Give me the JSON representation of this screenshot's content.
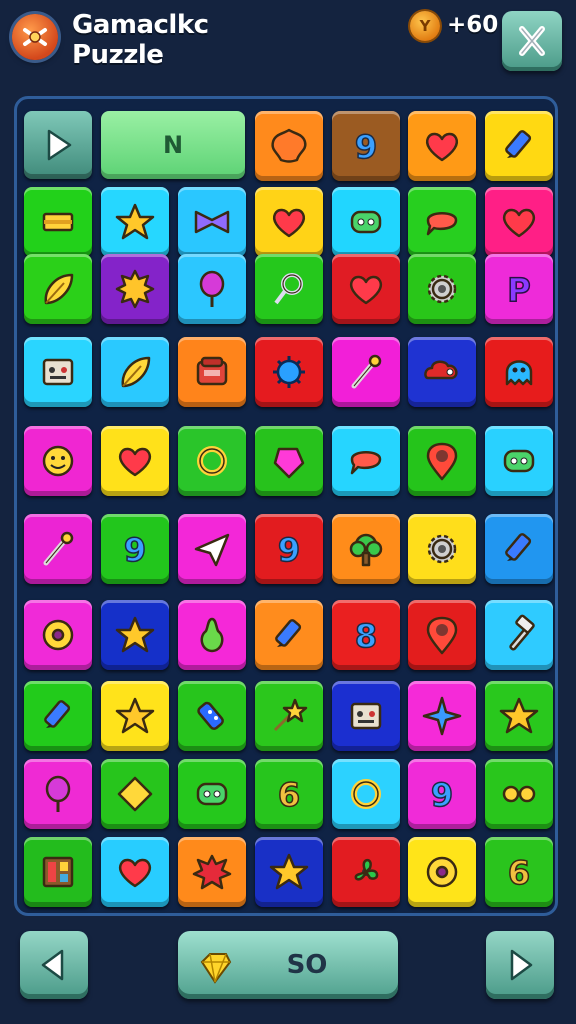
{
  "header": {
    "title_line1": "Gamaclkc",
    "title_line2": "Puzzle",
    "coin_icon_letter": "Y",
    "coin_value": "+60"
  },
  "board": {
    "first_row_label": "N",
    "rows": [
      [
        {
          "color": "#ff8a1c",
          "icon": "star-blob"
        },
        {
          "color": "#9b5b22",
          "icon": "number-9"
        },
        {
          "color": "#ff9a16",
          "icon": "heart"
        },
        {
          "color": "#ffd912",
          "icon": "marker"
        }
      ],
      [
        {
          "color": "#22d11a",
          "icon": "block"
        },
        {
          "color": "#26d7ff",
          "icon": "star"
        },
        {
          "color": "#2ac7ff",
          "icon": "bow"
        },
        {
          "color": "#ffd317",
          "icon": "heart"
        },
        {
          "color": "#21d6ff",
          "icon": "face"
        },
        {
          "color": "#27cf1f",
          "icon": "speech-bubble"
        },
        {
          "color": "#ff1f86",
          "icon": "heart"
        }
      ],
      [
        {
          "color": "#2bd019",
          "icon": "leaf"
        },
        {
          "color": "#8423c9",
          "icon": "sun"
        },
        {
          "color": "#2cc7ff",
          "icon": "balloon"
        },
        {
          "color": "#25c81c",
          "icon": "key-ring"
        },
        {
          "color": "#e01c24",
          "icon": "heart"
        },
        {
          "color": "#29c619",
          "icon": "gear"
        },
        {
          "color": "#ee2bd9",
          "icon": "letter-p"
        }
      ],
      [
        {
          "color": "#2ad5ff",
          "icon": "robot"
        },
        {
          "color": "#2ac9ff",
          "icon": "leaf"
        },
        {
          "color": "#ff841b",
          "icon": "box"
        },
        {
          "color": "#e51b1f",
          "icon": "spiky-ball"
        },
        {
          "color": "#f21fd8",
          "icon": "wand"
        },
        {
          "color": "#1f33d2",
          "icon": "cloud"
        },
        {
          "color": "#e71c1c",
          "icon": "octopus"
        }
      ],
      [
        {
          "color": "#f026d2",
          "icon": "smiley"
        },
        {
          "color": "#ffe11a",
          "icon": "heart"
        },
        {
          "color": "#2ac52a",
          "icon": "ring"
        },
        {
          "color": "#27c21c",
          "icon": "gem"
        },
        {
          "color": "#26d5ff",
          "icon": "speech-bubble"
        },
        {
          "color": "#25c41b",
          "icon": "pin"
        },
        {
          "color": "#29d1ff",
          "icon": "face"
        }
      ],
      [
        {
          "color": "#ec24d4",
          "icon": "wand"
        },
        {
          "color": "#22c61c",
          "icon": "number-9"
        },
        {
          "color": "#f327d8",
          "icon": "paper-plane"
        },
        {
          "color": "#e21c1f",
          "icon": "number-9"
        },
        {
          "color": "#ff8c1a",
          "icon": "tree"
        },
        {
          "color": "#ffde1b",
          "icon": "gear"
        },
        {
          "color": "#2196f0",
          "icon": "marker"
        }
      ],
      [
        {
          "color": "#f02ad8",
          "icon": "donut"
        },
        {
          "color": "#1530c9",
          "icon": "star"
        },
        {
          "color": "#f528d8",
          "icon": "pear"
        },
        {
          "color": "#ff8c1d",
          "icon": "marker"
        },
        {
          "color": "#ea2020",
          "icon": "number-8"
        },
        {
          "color": "#e31d1d",
          "icon": "pin"
        },
        {
          "color": "#2fcbff",
          "icon": "hammer"
        }
      ],
      [
        {
          "color": "#22cb1b",
          "icon": "marker"
        },
        {
          "color": "#ffe31b",
          "icon": "star"
        },
        {
          "color": "#27c51c",
          "icon": "usb"
        },
        {
          "color": "#2bc71c",
          "icon": "pin-star"
        },
        {
          "color": "#1b2fd0",
          "icon": "robot"
        },
        {
          "color": "#f52ad8",
          "icon": "sparkle"
        },
        {
          "color": "#29c81d",
          "icon": "star"
        }
      ],
      [
        {
          "color": "#ef2ad4",
          "icon": "balloon"
        },
        {
          "color": "#27c51c",
          "icon": "diamond"
        },
        {
          "color": "#25c81c",
          "icon": "face"
        },
        {
          "color": "#27c51d",
          "icon": "number-6"
        },
        {
          "color": "#2cd2ff",
          "icon": "ring"
        },
        {
          "color": "#f02bd8",
          "icon": "number-9"
        },
        {
          "color": "#29c61c",
          "icon": "glasses"
        }
      ],
      [
        {
          "color": "#23bc1d",
          "icon": "window"
        },
        {
          "color": "#28cdff",
          "icon": "heart"
        },
        {
          "color": "#ff8a1b",
          "icon": "splat"
        },
        {
          "color": "#1930c6",
          "icon": "star"
        },
        {
          "color": "#e21c21",
          "icon": "fan"
        },
        {
          "color": "#ffe419",
          "icon": "donut"
        },
        {
          "color": "#2ac41d",
          "icon": "number-6"
        }
      ]
    ]
  },
  "footer": {
    "score_value": "SO"
  }
}
